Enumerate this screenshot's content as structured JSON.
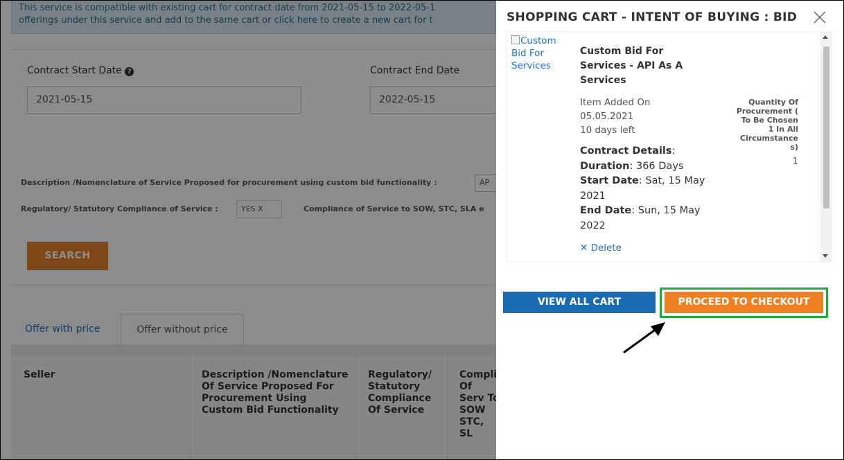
{
  "background": {
    "notice_line1": "This service is compatible with existing cart for contract date from 2021-05-15 to 2022-05-1",
    "notice_line2_prefix": "offerings under this service and add to the same cart or ",
    "notice_link": "click here",
    "notice_line2_suffix": " to create a new cart for t",
    "contract_start_label": "Contract Start Date",
    "contract_start_value": "2021-05-15",
    "contract_end_label": "Contract End Date",
    "contract_end_value": "2022-05-15",
    "description_label": "Description /Nomenclature of Service Proposed for procurement using custom bid functionality :",
    "description_chip": "AP",
    "regulatory_label": "Regulatory/ Statutory Compliance of Service :",
    "regulatory_chip": "YES  X",
    "compliance_label": "Compliance of Service to SOW, STC, SLA e",
    "search_button": "SEARCH",
    "tabs": [
      "Offer with price",
      "Offer without price"
    ],
    "table_headers": [
      "Seller",
      "Description /Nomenclature Of Service Proposed For Procurement Using Custom Bid Functionality",
      "Regulatory/ Statutory Compliance Of Service",
      "Compli Of Serv To SOW STC, SL"
    ]
  },
  "cart": {
    "title": "SHOPPING CART - INTENT OF BUYING : BID",
    "close_icon": "close-icon",
    "item": {
      "image_alt": "Custom Bid For Services",
      "name": "Custom Bid For Services - API As A Services",
      "added_label": "Item Added On",
      "added_date": "05.05.2021",
      "days_left": "10 days left",
      "contract_details_label": "Contract Details",
      "duration_label": "Duration",
      "duration_value": "366 Days",
      "start_label": "Start Date",
      "start_value": "Sat, 15 May 2021",
      "end_label": "End Date",
      "end_value": "Sun, 15 May 2022",
      "delete_label": "Delete",
      "quantity_label": "Quantity Of Procurement ( To Be Chosen 1 In All Circumstance s)",
      "quantity_value": "1"
    },
    "view_all_button": "VIEW ALL CART",
    "checkout_button": "PROCEED TO CHECKOUT"
  },
  "colors": {
    "highlight_green": "#1faa3a",
    "checkout_orange": "#f07f22",
    "view_blue": "#1b6bb3",
    "link_blue": "#1a73c8"
  }
}
